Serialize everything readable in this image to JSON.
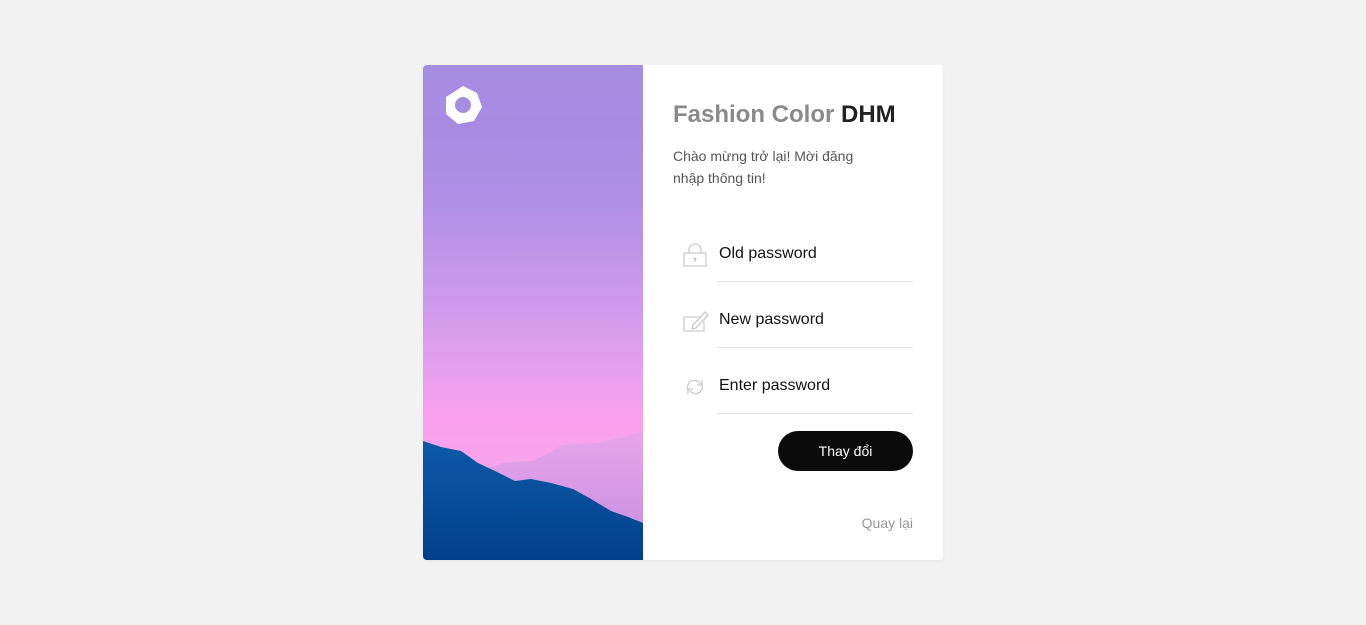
{
  "brand": {
    "title_light": "Fashion Color ",
    "title_strong": "DHM"
  },
  "welcome_text": "Chào mừng trở lại! Mời đăng nhập thông tin!",
  "form": {
    "fields": [
      {
        "icon": "lock-icon",
        "placeholder": "Old password",
        "value": ""
      },
      {
        "icon": "edit-icon",
        "placeholder": "New password",
        "value": ""
      },
      {
        "icon": "refresh-icon",
        "placeholder": "Enter password",
        "value": ""
      }
    ],
    "submit_label": "Thay đổi"
  },
  "back_link": "Quay lại",
  "colors": {
    "page_background": "#f2f2f2",
    "button_background": "#0b0b0b",
    "title_light": "#8a8a8a",
    "title_strong": "#222222"
  }
}
